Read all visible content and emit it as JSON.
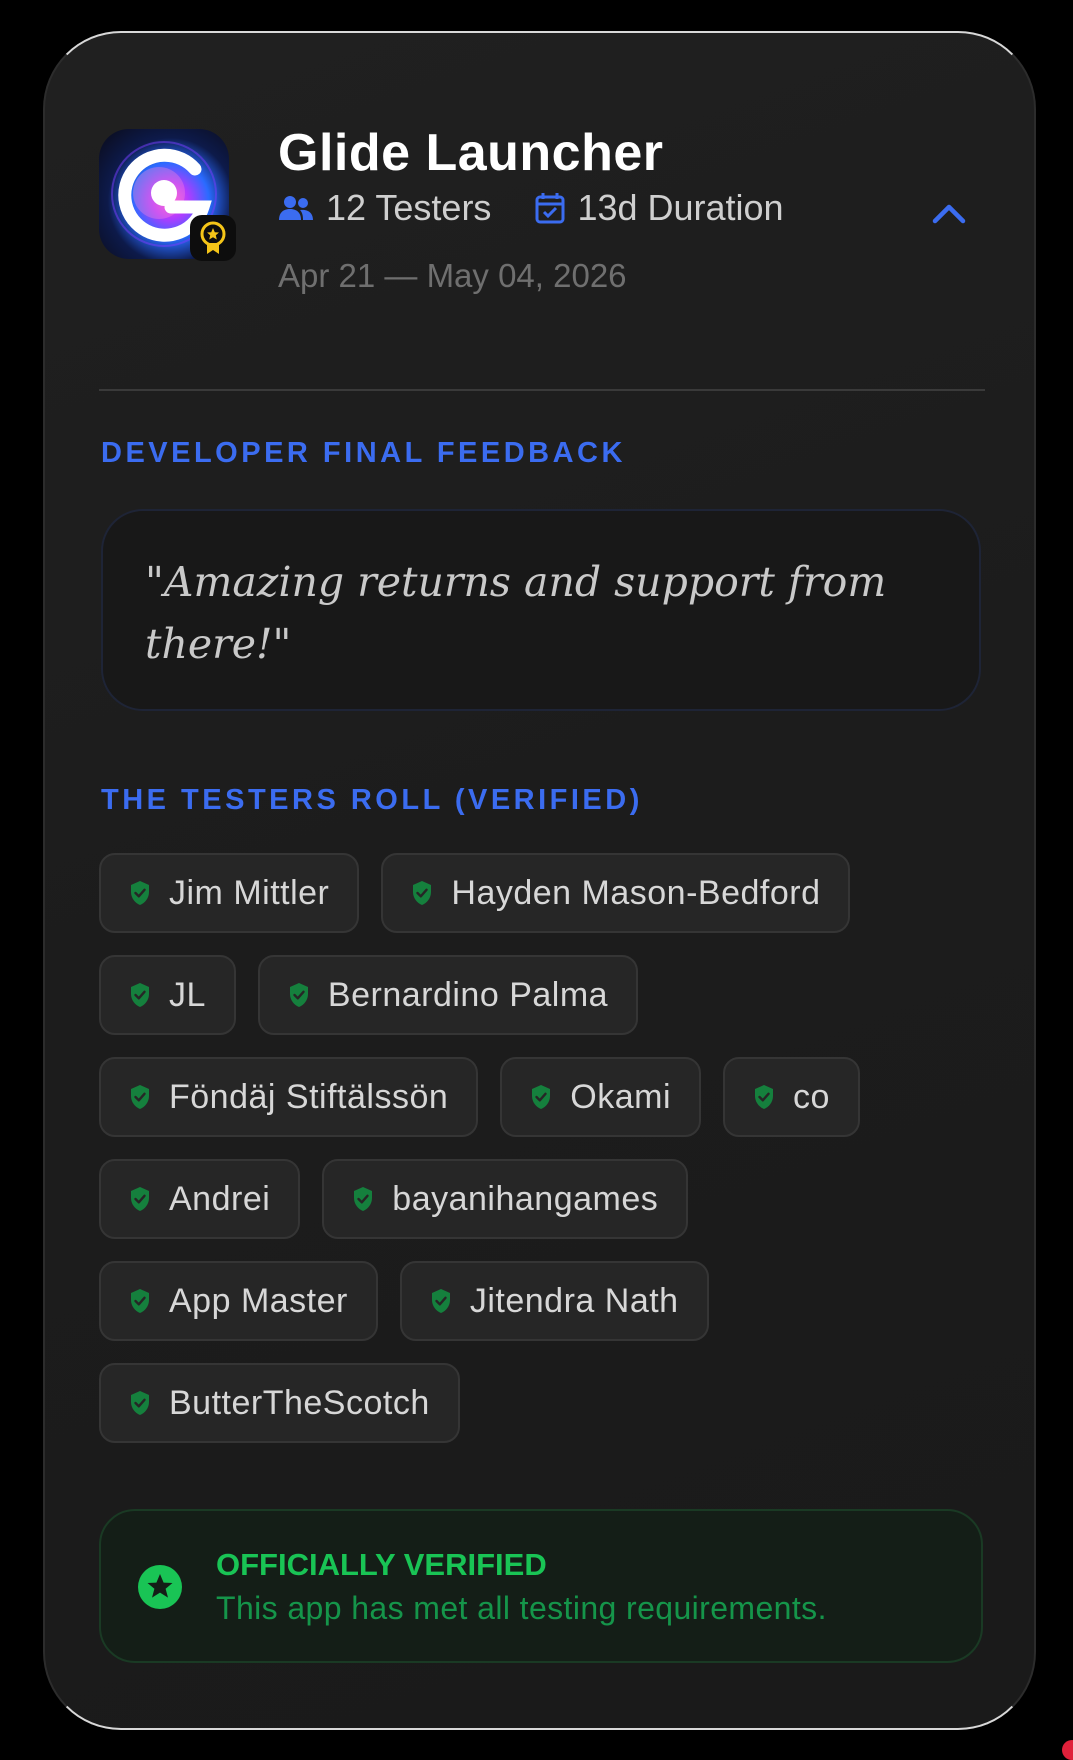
{
  "app": {
    "title": "Glide Launcher",
    "icon": "glide-launcher-logo",
    "badge_icon": "award-icon",
    "testers": "12 Testers",
    "duration": "13d Duration",
    "date_range": "Apr 21 — May 04, 2026",
    "collapse_icon": "chevron-up-icon"
  },
  "feedback": {
    "label": "DEVELOPER FINAL FEEDBACK",
    "quote": "\"Amazing returns and support from there!\""
  },
  "testers_roll": {
    "label": "THE TESTERS ROLL (VERIFIED)",
    "rows": [
      [
        "Jim Mittler",
        "Hayden Mason-Bedford"
      ],
      [
        "JL",
        "Bernardino Palma"
      ],
      [
        "Föndäj Stiftälssön",
        "Okami",
        "co"
      ],
      [
        "Andrei",
        "bayanihangames"
      ],
      [
        "App Master",
        "Jitendra Nath"
      ],
      [
        "ButterTheScotch"
      ]
    ]
  },
  "verification": {
    "title": "OFFICIALLY VERIFIED",
    "subtitle": "This app has met all testing requirements.",
    "icon": "verified-star-icon"
  },
  "colors": {
    "accent_blue": "#3b6cf0",
    "verified_green": "#19c455",
    "shield_green": "#15803d",
    "card_background": "#1e1e1e"
  }
}
